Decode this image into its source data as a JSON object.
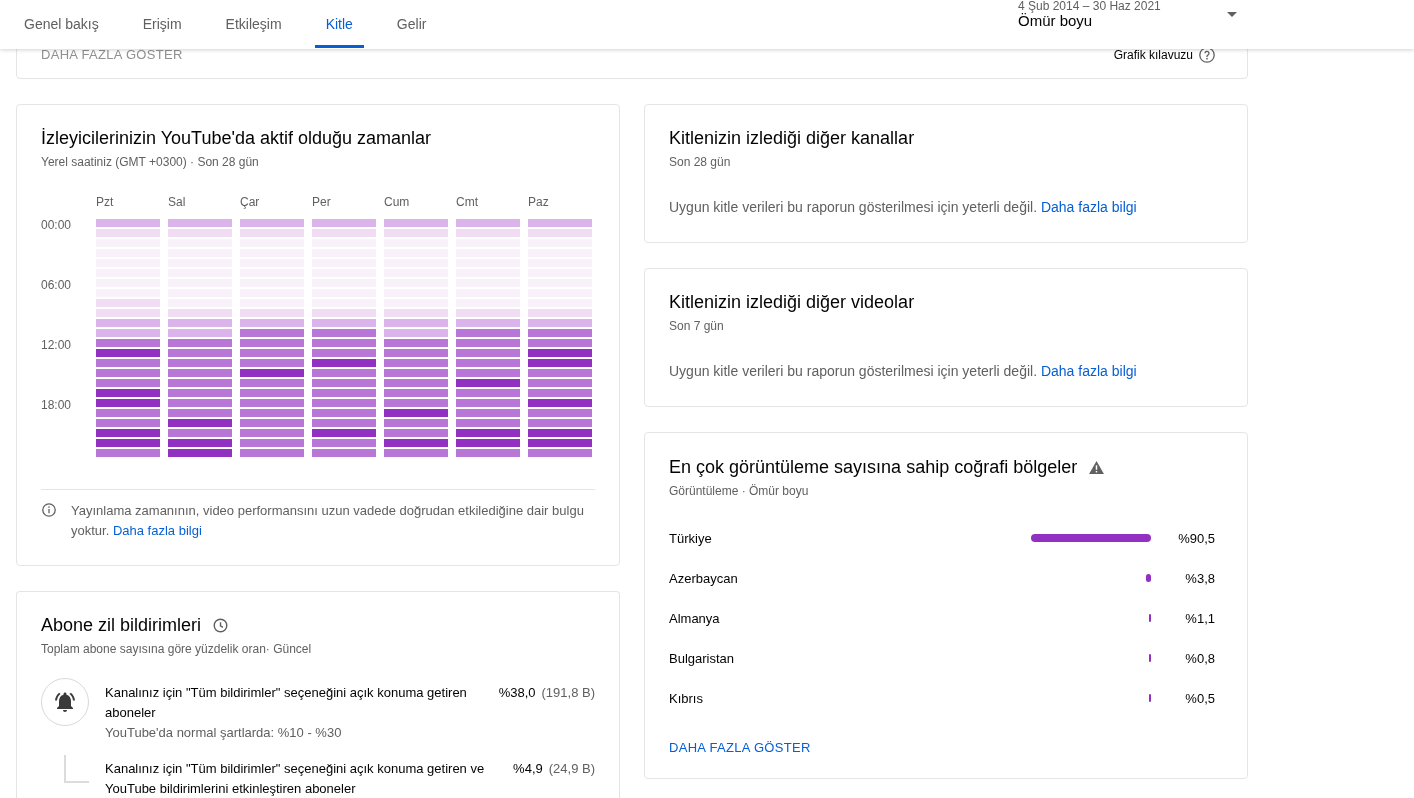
{
  "header": {
    "tabs": [
      {
        "label": "Genel bakış",
        "selected": false
      },
      {
        "label": "Erişim",
        "selected": false
      },
      {
        "label": "Etkileşim",
        "selected": false
      },
      {
        "label": "Kitle",
        "selected": true
      },
      {
        "label": "Gelir",
        "selected": false
      }
    ],
    "date_range": {
      "range": "4 Şub 2014 – 30 Haz 2021",
      "value": "Ömür boyu"
    }
  },
  "summary_card": {
    "show_more": "DAHA FAZLA GÖSTER",
    "chart_guide": "Grafik kılavuzu"
  },
  "active_times": {
    "title": "İzleyicilerinizin YouTube'da aktif olduğu zamanlar",
    "subtitle": "Yerel saatiniz (GMT +0300) · Son 28 gün",
    "hour_labels": [
      "00:00",
      "06:00",
      "12:00",
      "18:00"
    ],
    "days": [
      {
        "label": "Pzt",
        "cells": [
          {
            "color": "#dab4ea"
          },
          {
            "color": "#f0ddf3"
          },
          {
            "color": "#f8f1fa"
          },
          {
            "color": "#f8f1fa"
          },
          {
            "color": "#f8f1fa"
          },
          {
            "color": "#f8f1fa"
          },
          {
            "color": "#f8f1fa"
          },
          {
            "color": "#f8f1fa"
          },
          {
            "color": "#f0ddf3"
          },
          {
            "color": "#f0ddf3"
          },
          {
            "color": "#dab4ea"
          },
          {
            "color": "#dab4ea"
          },
          {
            "color": "#b877d6"
          },
          {
            "color": "#9130c1"
          },
          {
            "color": "#b877d6"
          },
          {
            "color": "#b877d6"
          },
          {
            "color": "#b877d6"
          },
          {
            "color": "#9130c1"
          },
          {
            "color": "#9130c1"
          },
          {
            "color": "#b877d6"
          },
          {
            "color": "#b877d6"
          },
          {
            "color": "#9130c1"
          },
          {
            "color": "#9130c1"
          },
          {
            "color": "#b877d6"
          }
        ]
      },
      {
        "label": "Sal",
        "cells": [
          {
            "color": "#dab4ea"
          },
          {
            "color": "#f0ddf3"
          },
          {
            "color": "#f8f1fa"
          },
          {
            "color": "#f8f1fa"
          },
          {
            "color": "#f8f1fa"
          },
          {
            "color": "#f8f1fa"
          },
          {
            "color": "#f8f1fa"
          },
          {
            "color": "#f8f1fa"
          },
          {
            "color": "#f8f1fa"
          },
          {
            "color": "#f0ddf3"
          },
          {
            "color": "#dab4ea"
          },
          {
            "color": "#dab4ea"
          },
          {
            "color": "#b877d6"
          },
          {
            "color": "#b877d6"
          },
          {
            "color": "#b877d6"
          },
          {
            "color": "#b877d6"
          },
          {
            "color": "#b877d6"
          },
          {
            "color": "#b877d6"
          },
          {
            "color": "#b877d6"
          },
          {
            "color": "#b877d6"
          },
          {
            "color": "#9130c1"
          },
          {
            "color": "#b877d6"
          },
          {
            "color": "#9130c1"
          },
          {
            "color": "#9130c1"
          }
        ]
      },
      {
        "label": "Çar",
        "cells": [
          {
            "color": "#dab4ea"
          },
          {
            "color": "#f0ddf3"
          },
          {
            "color": "#f8f1fa"
          },
          {
            "color": "#f8f1fa"
          },
          {
            "color": "#f8f1fa"
          },
          {
            "color": "#f8f1fa"
          },
          {
            "color": "#f8f1fa"
          },
          {
            "color": "#f8f1fa"
          },
          {
            "color": "#f8f1fa"
          },
          {
            "color": "#f0ddf3"
          },
          {
            "color": "#dab4ea"
          },
          {
            "color": "#b877d6"
          },
          {
            "color": "#b877d6"
          },
          {
            "color": "#b877d6"
          },
          {
            "color": "#b877d6"
          },
          {
            "color": "#9130c1"
          },
          {
            "color": "#b877d6"
          },
          {
            "color": "#b877d6"
          },
          {
            "color": "#b877d6"
          },
          {
            "color": "#b877d6"
          },
          {
            "color": "#b877d6"
          },
          {
            "color": "#b877d6"
          },
          {
            "color": "#b877d6"
          },
          {
            "color": "#b877d6"
          }
        ]
      },
      {
        "label": "Per",
        "cells": [
          {
            "color": "#dab4ea"
          },
          {
            "color": "#f0ddf3"
          },
          {
            "color": "#f8f1fa"
          },
          {
            "color": "#f8f1fa"
          },
          {
            "color": "#f8f1fa"
          },
          {
            "color": "#f8f1fa"
          },
          {
            "color": "#f8f1fa"
          },
          {
            "color": "#f8f1fa"
          },
          {
            "color": "#f8f1fa"
          },
          {
            "color": "#f0ddf3"
          },
          {
            "color": "#dab4ea"
          },
          {
            "color": "#b877d6"
          },
          {
            "color": "#b877d6"
          },
          {
            "color": "#b877d6"
          },
          {
            "color": "#9130c1"
          },
          {
            "color": "#b877d6"
          },
          {
            "color": "#b877d6"
          },
          {
            "color": "#b877d6"
          },
          {
            "color": "#b877d6"
          },
          {
            "color": "#b877d6"
          },
          {
            "color": "#b877d6"
          },
          {
            "color": "#9130c1"
          },
          {
            "color": "#b877d6"
          },
          {
            "color": "#b877d6"
          }
        ]
      },
      {
        "label": "Cum",
        "cells": [
          {
            "color": "#dab4ea"
          },
          {
            "color": "#f0ddf3"
          },
          {
            "color": "#f8f1fa"
          },
          {
            "color": "#f8f1fa"
          },
          {
            "color": "#f8f1fa"
          },
          {
            "color": "#f8f1fa"
          },
          {
            "color": "#f8f1fa"
          },
          {
            "color": "#f8f1fa"
          },
          {
            "color": "#f8f1fa"
          },
          {
            "color": "#f0ddf3"
          },
          {
            "color": "#dab4ea"
          },
          {
            "color": "#dab4ea"
          },
          {
            "color": "#b877d6"
          },
          {
            "color": "#b877d6"
          },
          {
            "color": "#b877d6"
          },
          {
            "color": "#b877d6"
          },
          {
            "color": "#b877d6"
          },
          {
            "color": "#b877d6"
          },
          {
            "color": "#b877d6"
          },
          {
            "color": "#9130c1"
          },
          {
            "color": "#b877d6"
          },
          {
            "color": "#b877d6"
          },
          {
            "color": "#9130c1"
          },
          {
            "color": "#b877d6"
          }
        ]
      },
      {
        "label": "Cmt",
        "cells": [
          {
            "color": "#dab4ea"
          },
          {
            "color": "#f0ddf3"
          },
          {
            "color": "#f8f1fa"
          },
          {
            "color": "#f8f1fa"
          },
          {
            "color": "#f8f1fa"
          },
          {
            "color": "#f8f1fa"
          },
          {
            "color": "#f8f1fa"
          },
          {
            "color": "#f8f1fa"
          },
          {
            "color": "#f8f1fa"
          },
          {
            "color": "#f0ddf3"
          },
          {
            "color": "#dab4ea"
          },
          {
            "color": "#b877d6"
          },
          {
            "color": "#b877d6"
          },
          {
            "color": "#b877d6"
          },
          {
            "color": "#b877d6"
          },
          {
            "color": "#b877d6"
          },
          {
            "color": "#9130c1"
          },
          {
            "color": "#b877d6"
          },
          {
            "color": "#b877d6"
          },
          {
            "color": "#b877d6"
          },
          {
            "color": "#b877d6"
          },
          {
            "color": "#9130c1"
          },
          {
            "color": "#9130c1"
          },
          {
            "color": "#b877d6"
          }
        ]
      },
      {
        "label": "Paz",
        "cells": [
          {
            "color": "#dab4ea"
          },
          {
            "color": "#f0ddf3"
          },
          {
            "color": "#f8f1fa"
          },
          {
            "color": "#f8f1fa"
          },
          {
            "color": "#f8f1fa"
          },
          {
            "color": "#f8f1fa"
          },
          {
            "color": "#f8f1fa"
          },
          {
            "color": "#f8f1fa"
          },
          {
            "color": "#f8f1fa"
          },
          {
            "color": "#f0ddf3"
          },
          {
            "color": "#dab4ea"
          },
          {
            "color": "#b877d6"
          },
          {
            "color": "#b877d6"
          },
          {
            "color": "#9130c1"
          },
          {
            "color": "#9130c1"
          },
          {
            "color": "#b877d6"
          },
          {
            "color": "#b877d6"
          },
          {
            "color": "#b877d6"
          },
          {
            "color": "#9130c1"
          },
          {
            "color": "#b877d6"
          },
          {
            "color": "#b877d6"
          },
          {
            "color": "#9130c1"
          },
          {
            "color": "#9130c1"
          },
          {
            "color": "#b877d6"
          }
        ]
      }
    ],
    "note": "Yayınlama zamanının, video performansını uzun vadede doğrudan etkilediğine dair bulgu yoktur.",
    "note_link": "Daha fazla bilgi"
  },
  "bell_notifications": {
    "title": "Abone zil bildirimleri",
    "subtitle": "Toplam abone sayısına göre yüzdelik oran· Güncel",
    "rows": [
      {
        "kind": "main",
        "text": "Kanalınız için \"Tüm bildirimler\" seçeneğini açık konuma getiren aboneler",
        "note": "YouTube'da normal şartlarda: %10 - %30",
        "percent": "%38,0",
        "count": "(191,8 B)"
      },
      {
        "kind": "sub",
        "text": "Kanalınız için \"Tüm bildirimler\" seçeneğini açık konuma getiren ve YouTube bildirimlerini etkinleştiren aboneler",
        "percent": "%4,9",
        "count": "(24,9 B)"
      }
    ]
  },
  "other_channels": {
    "title": "Kitlenizin izlediği diğer kanallar",
    "subtitle": "Son 28 gün",
    "message": "Uygun kitle verileri bu raporun gösterilmesi için yeterli değil.",
    "link": "Daha fazla bilgi"
  },
  "other_videos": {
    "title": "Kitlenizin izlediği diğer videolar",
    "subtitle": "Son 7 gün",
    "message": "Uygun kitle verileri bu raporun gösterilmesi için yeterli değil.",
    "link": "Daha fazla bilgi"
  },
  "geographies": {
    "title": "En çok görüntüleme sayısına sahip coğrafi bölgeler",
    "subtitle": "Görüntüleme · Ömür boyu",
    "chart_data": {
      "type": "bar",
      "orientation": "horizontal",
      "categories": [
        "Türkiye",
        "Azerbaycan",
        "Almanya",
        "Bulgaristan",
        "Kıbrıs"
      ],
      "values": [
        90.5,
        3.8,
        1.1,
        0.8,
        0.5
      ],
      "data_labels": true,
      "value_labels": [
        "%90,5",
        "%3,8",
        "%1,1",
        "%0,8",
        "%0,5"
      ]
    },
    "show_more": "DAHA FAZLA GÖSTER"
  }
}
